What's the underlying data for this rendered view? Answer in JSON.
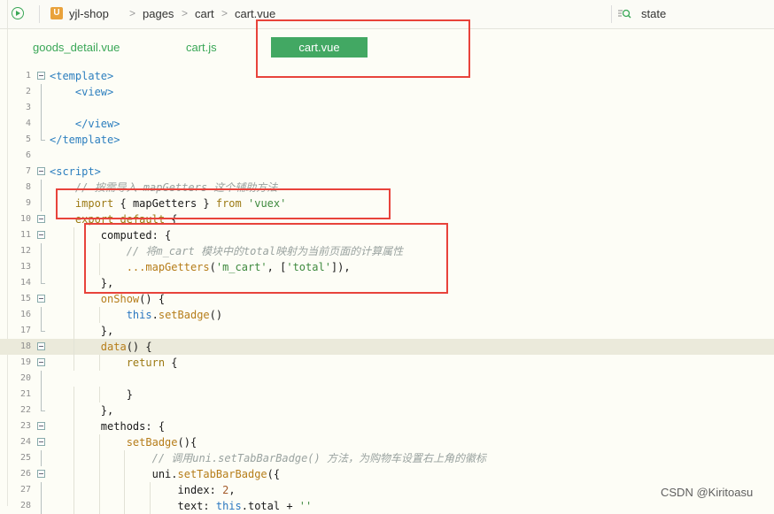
{
  "breadcrumb": {
    "project_icon_letter": "U",
    "items": [
      "yjl-shop",
      "pages",
      "cart",
      "cart.vue"
    ]
  },
  "search": {
    "text": "state"
  },
  "tabs": [
    {
      "label": "goods_detail.vue",
      "active": false
    },
    {
      "label": "cart.js",
      "active": false
    },
    {
      "label": "cart.vue",
      "active": true
    }
  ],
  "colors": {
    "accent": "#42a863",
    "annotation": "#e8433b",
    "highlight_line": "#ebeadb"
  },
  "editor": {
    "highlighted_line": 18,
    "lines": [
      {
        "n": "1",
        "text": "<template>"
      },
      {
        "n": "2",
        "text": "    <view>"
      },
      {
        "n": "3",
        "text": ""
      },
      {
        "n": "4",
        "text": "    </view>"
      },
      {
        "n": "5",
        "text": "</template>"
      },
      {
        "n": "6",
        "text": ""
      },
      {
        "n": "7",
        "text": "<script>"
      },
      {
        "n": "8",
        "text": "    // 按需导入 mapGetters 这个辅助方法"
      },
      {
        "n": "9",
        "text": "    import { mapGetters } from 'vuex'"
      },
      {
        "n": "10",
        "text": "    export default {"
      },
      {
        "n": "11",
        "text": "        computed: {"
      },
      {
        "n": "12",
        "text": "            // 将m_cart 模块中的total映射为当前页面的计算属性"
      },
      {
        "n": "13",
        "text": "            ...mapGetters('m_cart', ['total']),"
      },
      {
        "n": "14",
        "text": "        },"
      },
      {
        "n": "15",
        "text": "        onShow() {"
      },
      {
        "n": "16",
        "text": "            this.setBadge()"
      },
      {
        "n": "17",
        "text": "        },"
      },
      {
        "n": "18",
        "text": "        data() {"
      },
      {
        "n": "19",
        "text": "            return {"
      },
      {
        "n": "20",
        "text": ""
      },
      {
        "n": "21",
        "text": "            }"
      },
      {
        "n": "22",
        "text": "        },"
      },
      {
        "n": "23",
        "text": "        methods: {"
      },
      {
        "n": "24",
        "text": "            setBadge(){"
      },
      {
        "n": "25",
        "text": "                // 调用uni.setTabBarBadge() 方法，为购物车设置右上角的徽标"
      },
      {
        "n": "26",
        "text": "                uni.setTabBarBadge({"
      },
      {
        "n": "27",
        "text": "                    index: 2,"
      },
      {
        "n": "28",
        "text": "                    text: this.total + ''"
      }
    ]
  },
  "watermark": "CSDN @Kiritoasu"
}
